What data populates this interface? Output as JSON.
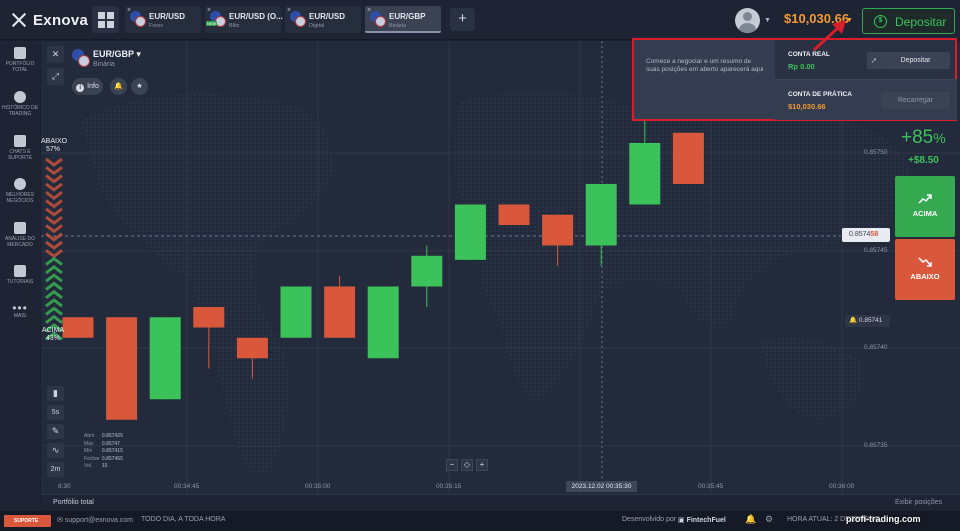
{
  "app": {
    "logo": "Exnova"
  },
  "tabs": [
    {
      "name": "EUR/USD",
      "sub": "Forex"
    },
    {
      "name": "EUR/USD (O...",
      "sub": "Blitz",
      "badge": "NEW"
    },
    {
      "name": "EUR/USD",
      "sub": "Digital"
    },
    {
      "name": "EUR/GBP",
      "sub": "Binária"
    }
  ],
  "header": {
    "balance": "$10,030.66",
    "deposit_label": "Depositar"
  },
  "sidebar": {
    "items": [
      "PORTFÓLIO TOTAL",
      "HISTÓRICO DE TRADING",
      "CHATS E SUPORTE",
      "MELHORES NEGÓCIOS",
      "ANÁLISE DO MERCADO",
      "TUTORIAIS",
      "MAIS"
    ]
  },
  "asset": {
    "name": "EUR/GBP",
    "type": "Binária",
    "info_label": "Info"
  },
  "sentiment": {
    "down_label": "ABAIXO",
    "down_pct": "57%",
    "up_label": "ACIMA",
    "up_pct": "43%"
  },
  "tools": {
    "time_5s": "5s",
    "period_2m": "2m"
  },
  "ohlc": {
    "labels": [
      "Abrir",
      "Máx",
      "Mín",
      "Fechar",
      "Vol."
    ],
    "values": [
      "0.857425",
      "0.85747",
      "0.857415",
      "0.857455",
      "15"
    ]
  },
  "price_axis": {
    "labels": [
      "0.85750",
      "0.85745",
      "0.85740",
      "0.85735"
    ],
    "current_prefix": "0.8574",
    "current_suffix": "58",
    "alert_value": "0.85741"
  },
  "time_axis": {
    "labels": [
      "6:30",
      "00:34:45",
      "00:35:00",
      "00:35:15",
      "00:35:45",
      "00:36:00"
    ],
    "current": "2023.12.02 00:35:30"
  },
  "trade": {
    "payout": "+85",
    "payout_unit": "%",
    "profit": "+$8.50",
    "up_label": "ACIMA",
    "down_label": "ABAIXO"
  },
  "popup": {
    "message": "Comece a negociar e um resumo de suas posições em aberto aparecerá aqui",
    "real_title": "CONTA REAL",
    "real_value": "Rp 0.00",
    "real_button": "Depositar",
    "practice_title": "CONTA DE PRÁTICA",
    "practice_value": "$10,030.66",
    "practice_button": "Recarregar"
  },
  "bottom": {
    "portfolio_label": "Portfólio total",
    "show_positions": "Exibir posições"
  },
  "status": {
    "support_label": "SUPORTE",
    "email": "support@exnova.com",
    "hours": "TODO DIA, A TODA HORA",
    "developed": "Desenvolvido por",
    "fintech": "FintechFuel",
    "current_time": "HORA ATUAL: 2 DEZEMBRO,",
    "watermark": "profi-trading.com"
  },
  "colors": {
    "green": "#3cc25a",
    "red": "#d9573b",
    "orange": "#f39a34"
  },
  "chart_data": {
    "type": "candlestick",
    "candles": [
      {
        "o": 0.857405,
        "c": 0.857395,
        "h": 0.857405,
        "l": 0.857395
      },
      {
        "o": 0.857405,
        "c": 0.857355,
        "h": 0.857405,
        "l": 0.857355
      },
      {
        "o": 0.857365,
        "c": 0.857405,
        "h": 0.857405,
        "l": 0.857365
      },
      {
        "o": 0.85741,
        "c": 0.8574,
        "h": 0.85741,
        "l": 0.85738
      },
      {
        "o": 0.857395,
        "c": 0.857385,
        "h": 0.857395,
        "l": 0.857375
      },
      {
        "o": 0.857395,
        "c": 0.85742,
        "h": 0.85742,
        "l": 0.857395
      },
      {
        "o": 0.85742,
        "c": 0.857395,
        "h": 0.857425,
        "l": 0.857395
      },
      {
        "o": 0.857385,
        "c": 0.85742,
        "h": 0.85742,
        "l": 0.857385
      },
      {
        "o": 0.85742,
        "c": 0.857435,
        "h": 0.85744,
        "l": 0.85741
      },
      {
        "o": 0.857433,
        "c": 0.85746,
        "h": 0.85746,
        "l": 0.857433
      },
      {
        "o": 0.85746,
        "c": 0.85745,
        "h": 0.85746,
        "l": 0.85745
      },
      {
        "o": 0.857455,
        "c": 0.85744,
        "h": 0.857455,
        "l": 0.85743
      },
      {
        "o": 0.85744,
        "c": 0.85747,
        "h": 0.85747,
        "l": 0.85743
      },
      {
        "o": 0.85746,
        "c": 0.85749,
        "h": 0.857505,
        "l": 0.85746
      },
      {
        "o": 0.857495,
        "c": 0.85747,
        "h": 0.857495,
        "l": 0.85747
      }
    ],
    "ylim": [
      0.85733,
      0.85753
    ],
    "grid": true
  }
}
